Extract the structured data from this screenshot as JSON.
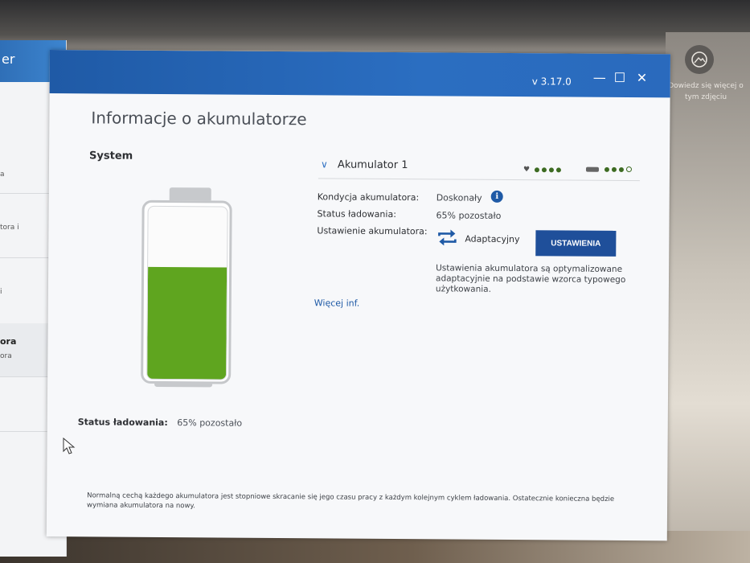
{
  "sidebar": {
    "header_fragment": "er",
    "items": [
      {
        "text": "a"
      },
      {
        "text": "tora i"
      },
      {
        "text": "i"
      },
      {
        "bold": "ora",
        "text": "ora"
      },
      {
        "text": ""
      }
    ]
  },
  "desktop": {
    "caption": "Dowiedz się więcej o tym zdjęciu"
  },
  "window": {
    "version": "v 3.17.0",
    "minimize": "—",
    "maximize": "☐",
    "close": "✕"
  },
  "page": {
    "title": "Informacje o akumulatorze",
    "system_label": "System",
    "charge_status_label": "Status ładowania:",
    "charge_status_value": "65% pozostało"
  },
  "battery": {
    "level_percent": 65,
    "fill_color": "#5fa51f"
  },
  "accumulator": {
    "title": "Akumulator 1",
    "health_indicator": {
      "icon": "heart-icon",
      "filled": 4,
      "total": 4
    },
    "charge_indicator": {
      "icon": "plug-icon",
      "filled": 3,
      "total": 4
    },
    "rows": {
      "condition_label": "Kondycja akumulatora:",
      "condition_value": "Doskonały",
      "charge_label": "Status ładowania:",
      "charge_value": "65% pozostało",
      "setting_label": "Ustawienie akumulatora:",
      "setting_value": "Adaptacyjny"
    },
    "settings_button": "USTAWIENIA",
    "description": "Ustawienia akumulatora są optymalizowane adaptacyjnie na podstawie wzorca typowego użytkowania.",
    "more_link": "Więcej inf."
  },
  "footer_note": "Normalną cechą każdego akumulatora jest stopniowe skracanie się jego czasu pracy z każdym kolejnym cyklem ładowania. Ostatecznie konieczna będzie wymiana akumulatora na nowy.",
  "colors": {
    "titlebar": "#1f5aa6",
    "accent": "#1f4f9a",
    "indicator": "#3d6b22"
  }
}
